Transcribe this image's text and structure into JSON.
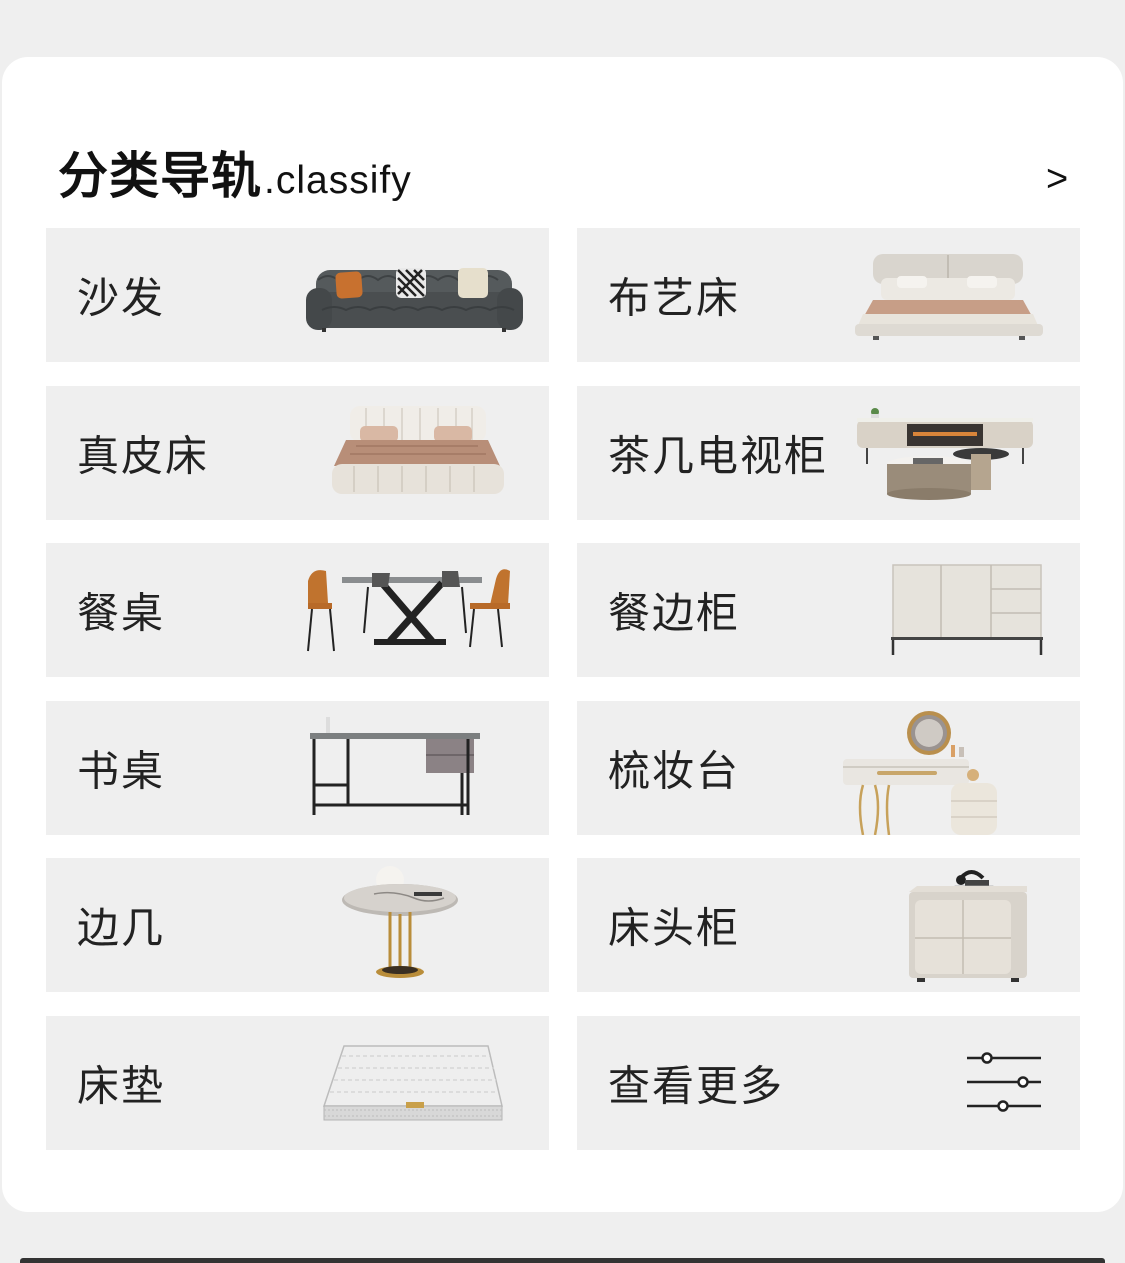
{
  "header": {
    "title_cn": "分类导轨",
    "title_en": ".classify",
    "more_label": ">"
  },
  "categories": [
    {
      "label": "沙发",
      "icon": "sofa-icon"
    },
    {
      "label": "布艺床",
      "icon": "fabric-bed-icon"
    },
    {
      "label": "真皮床",
      "icon": "leather-bed-icon"
    },
    {
      "label": "茶几电视柜",
      "icon": "tv-cabinet-coffee-table-icon"
    },
    {
      "label": "餐桌",
      "icon": "dining-table-icon"
    },
    {
      "label": "餐边柜",
      "icon": "sideboard-icon"
    },
    {
      "label": "书桌",
      "icon": "desk-icon"
    },
    {
      "label": "梳妆台",
      "icon": "dressing-table-icon"
    },
    {
      "label": "边几",
      "icon": "side-table-icon"
    },
    {
      "label": "床头柜",
      "icon": "nightstand-icon"
    },
    {
      "label": "床垫",
      "icon": "mattress-icon"
    },
    {
      "label": "查看更多",
      "icon": "filter-sliders-icon"
    }
  ]
}
